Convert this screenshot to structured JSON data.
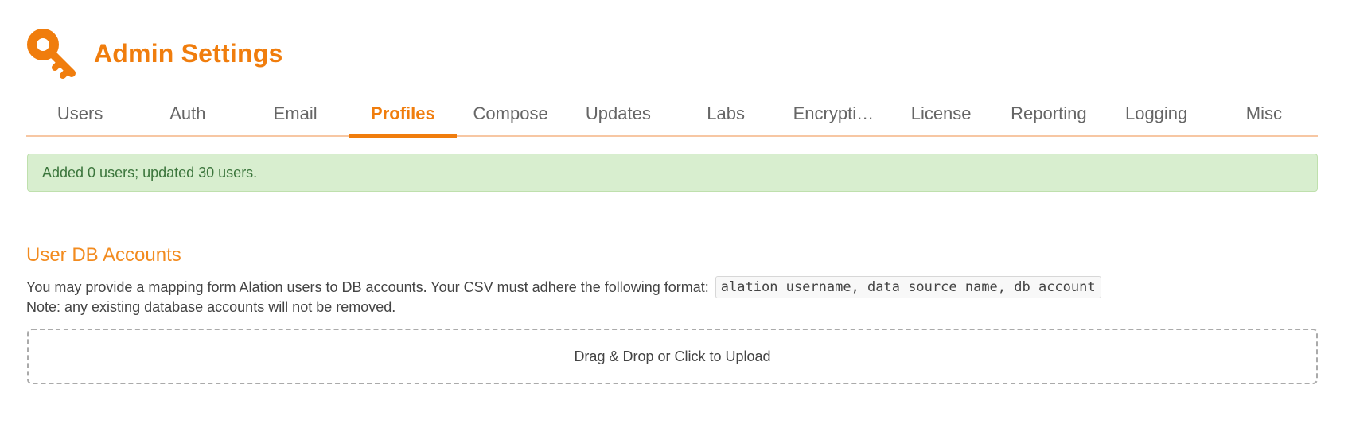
{
  "header": {
    "icon": "key-icon",
    "title": "Admin Settings",
    "accent_color": "#f07d0d"
  },
  "tabs": [
    {
      "label": "Users"
    },
    {
      "label": "Auth"
    },
    {
      "label": "Email"
    },
    {
      "label": "Profiles",
      "active": true
    },
    {
      "label": "Compose"
    },
    {
      "label": "Updates"
    },
    {
      "label": "Labs"
    },
    {
      "label": "Encrypti…"
    },
    {
      "label": "License"
    },
    {
      "label": "Reporting"
    },
    {
      "label": "Logging"
    },
    {
      "label": "Misc"
    }
  ],
  "alert": {
    "message": "Added 0 users; updated 30 users.",
    "color": "#3c763d",
    "background": "#d8eecf"
  },
  "section": {
    "title": "User DB Accounts",
    "description": "You may provide a mapping form Alation users to DB accounts. Your CSV must adhere the following format:",
    "format": "alation username, data source name, db account",
    "note": "Note: any existing database accounts will not be removed.",
    "upload_label": "Drag & Drop or Click to Upload"
  }
}
